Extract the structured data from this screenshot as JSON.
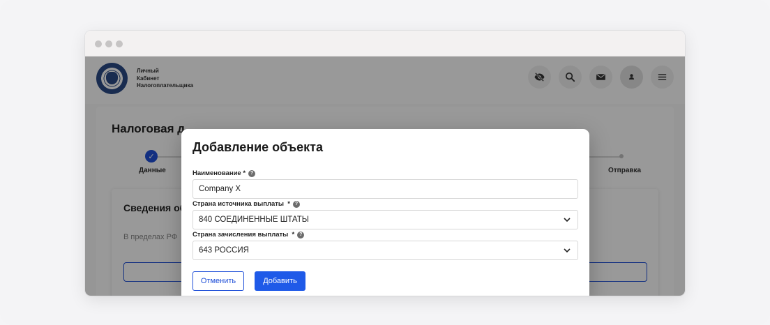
{
  "header": {
    "brand_lines": [
      "Личный",
      "Кабинет",
      "Налогоплательщика"
    ],
    "icons": [
      "eye-off-icon",
      "search-icon",
      "mail-icon",
      "user-icon",
      "menu-icon"
    ]
  },
  "page": {
    "title": "Налоговая д",
    "steps": [
      {
        "label": "Данные"
      },
      {
        "label": "Отправка"
      }
    ],
    "section_title": "Сведения об",
    "section_subtitle": "В пределах РФ"
  },
  "modal": {
    "title": "Добавление объекта",
    "fields": [
      {
        "label": "Наименование *",
        "value": "Company X",
        "type": "text"
      },
      {
        "label": "Страна источника выплаты  *",
        "value": "840 СОЕДИНЕННЫЕ ШТАТЫ",
        "type": "select"
      },
      {
        "label": "Страна зачисления выплаты  *",
        "value": "643 РОССИЯ",
        "type": "select"
      }
    ],
    "cancel_label": "Отменить",
    "add_label": "Добавить"
  },
  "colors": {
    "accent": "#1f5ae8",
    "overlay": "rgba(0,0,0,0.40)"
  }
}
